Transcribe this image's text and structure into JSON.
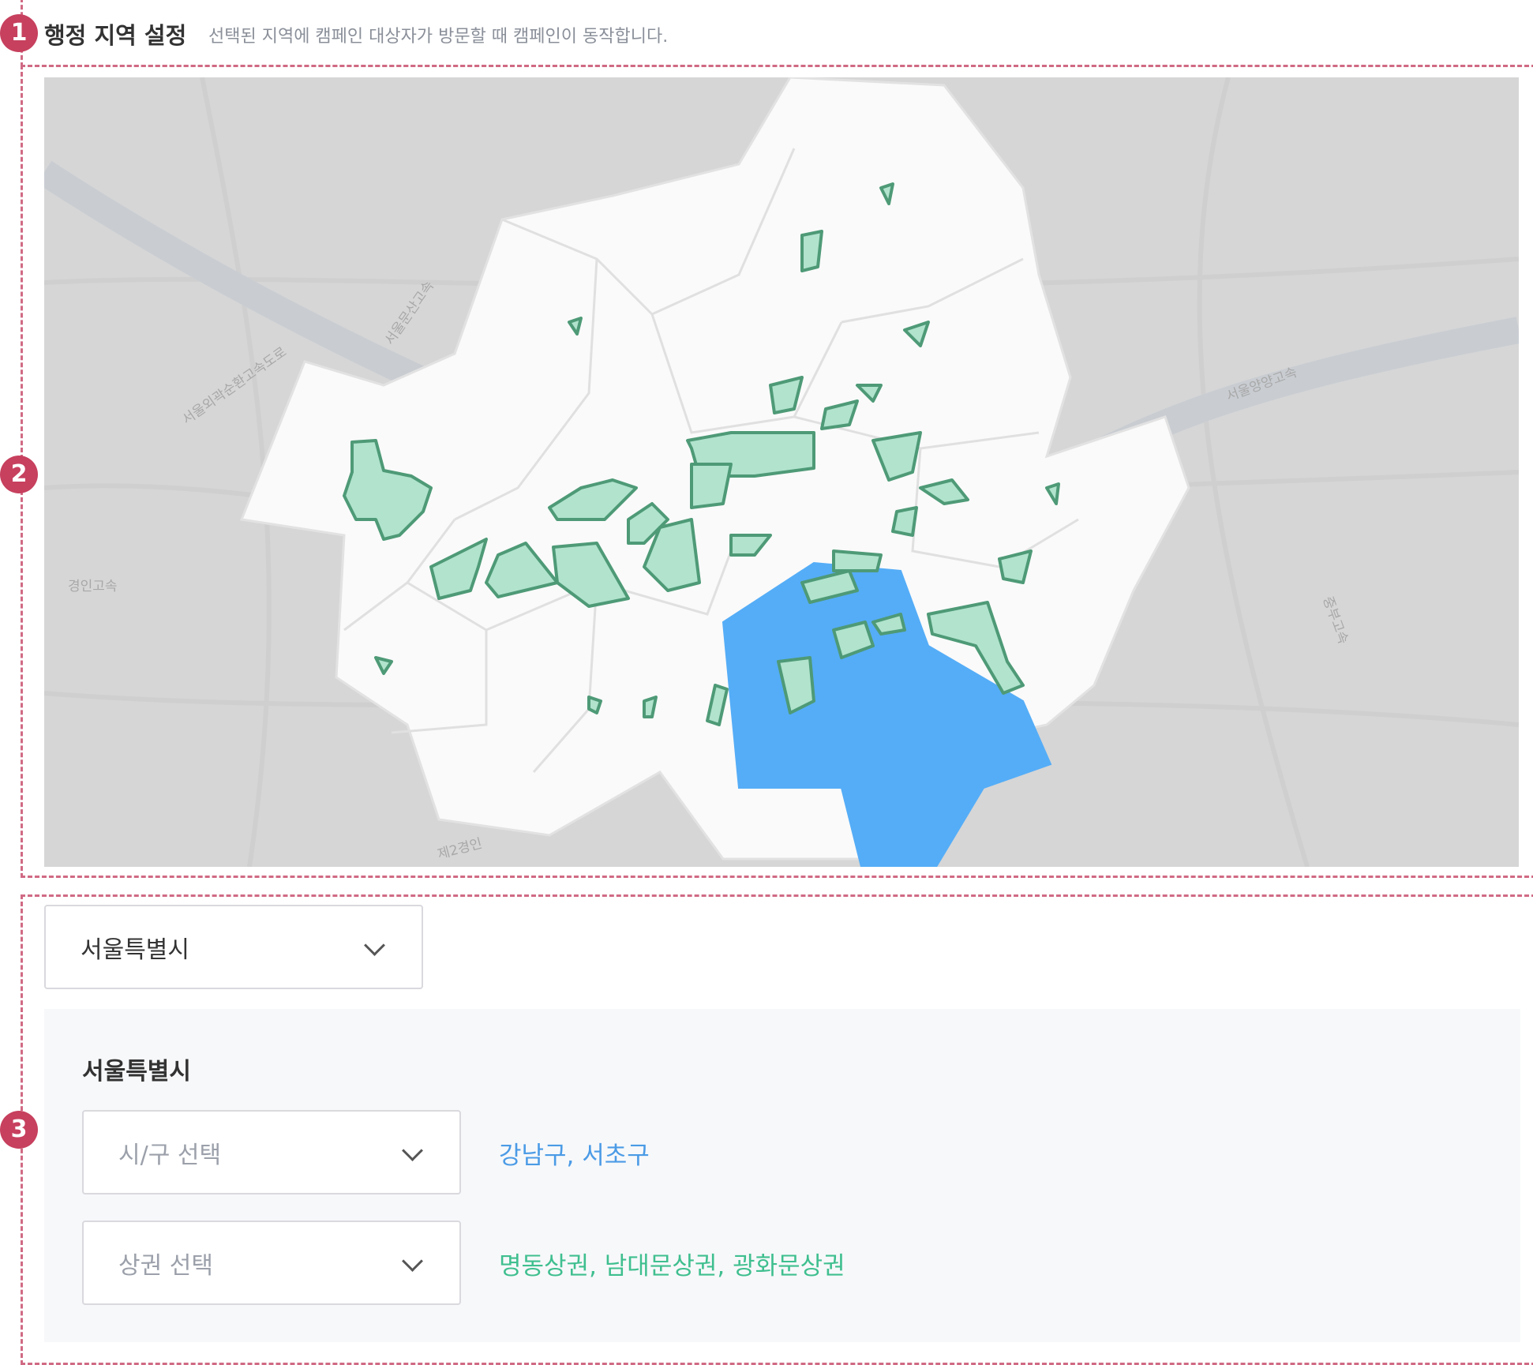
{
  "sections": {
    "markers": [
      "1",
      "2",
      "3"
    ]
  },
  "header": {
    "title": "행정 지역 설정",
    "description": "선택된 지역에 캠페인 대상자가 방문할 때 캠페인이 동작합니다."
  },
  "map": {
    "road_labels": [
      "경인고속",
      "서울외곽순환고속도로",
      "서울문산고속",
      "서울양양고속",
      "중부고속",
      "제2경인"
    ],
    "selected_district_color": "#55adf7",
    "commercial_area_color": "#b1e3cd",
    "commercial_area_stroke": "#4e9a77"
  },
  "region_select": {
    "value": "서울특별시"
  },
  "panel": {
    "title": "서울특별시",
    "district_select": {
      "placeholder": "시/구 선택"
    },
    "area_select": {
      "placeholder": "상권 선택"
    },
    "selected_districts": "강남구, 서초구",
    "selected_areas": "명동상권, 남대문상권, 광화문상권"
  },
  "colors": {
    "marker": "#c7405e",
    "dashed_border": "#d06a84",
    "district_text": "#4b9be6",
    "area_text": "#3fbf8f"
  }
}
